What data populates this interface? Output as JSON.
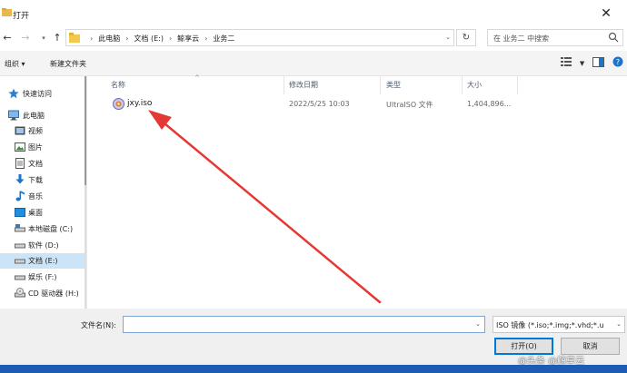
{
  "window": {
    "title": "打开",
    "close_glyph": "✕"
  },
  "address": {
    "crumbs": [
      "此电脑",
      "文档 (E:)",
      "鲸享云",
      "业务二"
    ],
    "search_placeholder": "在 业务二 中搜索"
  },
  "toolbar": {
    "organize_label": "组织 ▾",
    "new_folder_label": "新建文件夹"
  },
  "sidebar": {
    "items": [
      {
        "label": "快速访问",
        "icon": "star-icon"
      },
      {
        "label": "此电脑",
        "icon": "computer-icon"
      },
      {
        "label": "视频",
        "icon": "video-icon"
      },
      {
        "label": "图片",
        "icon": "picture-icon"
      },
      {
        "label": "文档",
        "icon": "document-icon"
      },
      {
        "label": "下载",
        "icon": "download-icon"
      },
      {
        "label": "音乐",
        "icon": "music-icon"
      },
      {
        "label": "桌面",
        "icon": "desktop-icon"
      },
      {
        "label": "本地磁盘 (C:)",
        "icon": "drive-icon"
      },
      {
        "label": "软件 (D:)",
        "icon": "drive-icon"
      },
      {
        "label": "文档 (E:)",
        "icon": "drive-icon",
        "selected": true
      },
      {
        "label": "娱乐 (F:)",
        "icon": "drive-icon"
      },
      {
        "label": "CD 驱动器 (H:)",
        "icon": "cd-drive-icon"
      }
    ]
  },
  "columns": {
    "name": "名称",
    "modified": "修改日期",
    "type": "类型",
    "size": "大小"
  },
  "files": [
    {
      "name": "jxy.iso",
      "modified": "2022/5/25 10:03",
      "type": "UltraISO 文件",
      "size": "1,404,896..."
    }
  ],
  "bottom": {
    "filename_label": "文件名(N):",
    "filename_value": "",
    "filter_value": "ISO 镜像 (*.iso;*.img;*.vhd;*.u",
    "open_label": "打开(O)",
    "cancel_label": "取消",
    "watermark": "@头条 @鲸享云"
  },
  "colors": {
    "accent": "#0078d7",
    "arrow": "#e53935",
    "selection": "#cce4f7"
  }
}
